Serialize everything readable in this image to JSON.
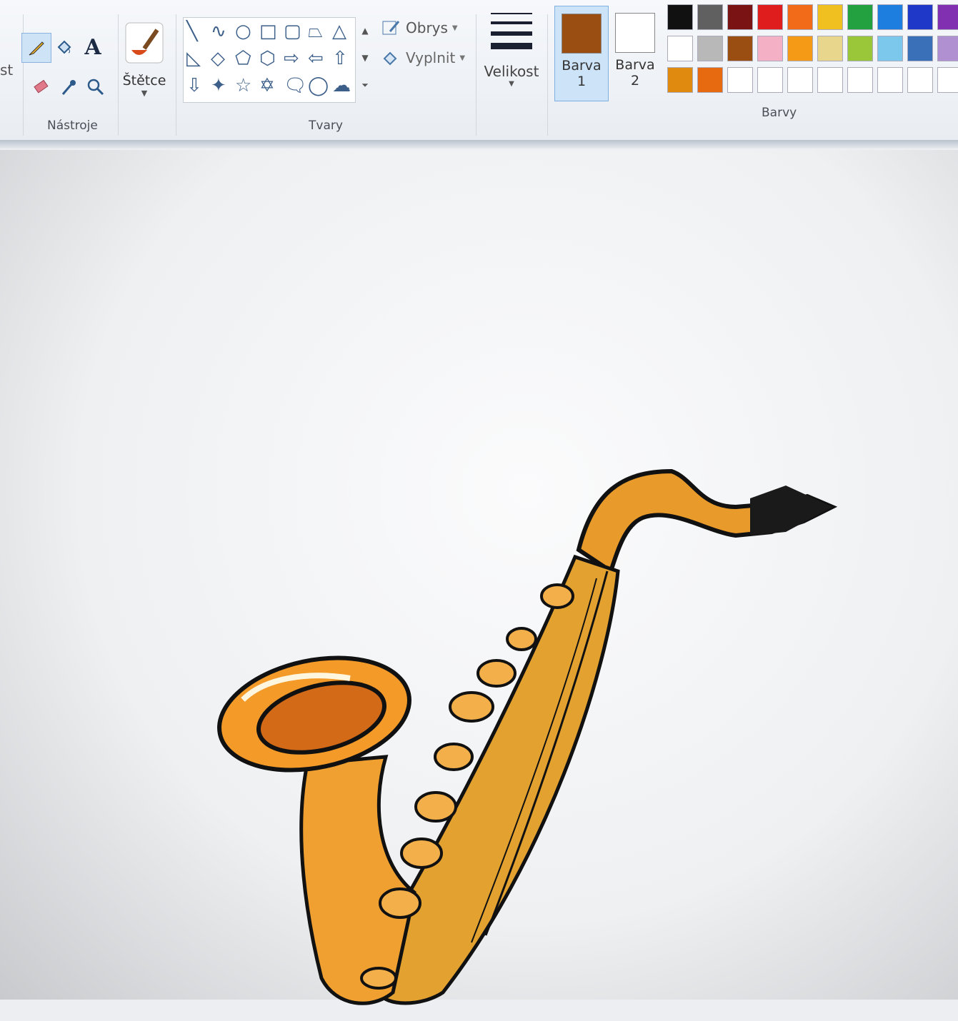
{
  "ribbon": {
    "left_cut_label": "st",
    "groups": {
      "tools": "Nástroje",
      "brushes": "Štětce",
      "shapes": "Tvary",
      "outline": "Obrys",
      "fill": "Vyplnit",
      "size": "Velikost",
      "colors": "Barvy"
    },
    "color1": {
      "label": "Barva",
      "number": "1",
      "value": "#9a4e12"
    },
    "color2": {
      "label": "Barva",
      "number": "2",
      "value": "#ffffff"
    }
  },
  "palette": [
    [
      "#111111",
      "#606060",
      "#7a1414",
      "#e01d1d",
      "#f26b18",
      "#f0c020",
      "#23a040",
      "#1e7ee0",
      "#2038c8",
      "#8030b0"
    ],
    [
      "#ffffff",
      "#b8b8b8",
      "#9a4e12",
      "#f4b0c4",
      "#f59a16",
      "#e8d68c",
      "#9ac63a",
      "#7cc8ec",
      "#3a70b8",
      "#b090d0"
    ],
    [
      "#e08a10",
      "#e86a10",
      "#ffffff",
      "#ffffff",
      "#ffffff",
      "#ffffff",
      "#ffffff",
      "#ffffff",
      "#ffffff",
      "#ffffff"
    ]
  ],
  "icons": {
    "pencil": "pencil-icon",
    "fill": "fill-bucket-icon",
    "text": "text-icon",
    "eraser": "eraser-icon",
    "picker": "color-picker-icon",
    "magnifier": "magnifier-icon"
  },
  "text_glyph": "A",
  "shape_glyphs": [
    [
      "╲",
      "∿",
      "○",
      "□",
      "▢",
      "⏢",
      "△"
    ],
    [
      "◺",
      "◇",
      "⬠",
      "⬡",
      "⇨",
      "⇦",
      "⇧"
    ],
    [
      "⇩",
      "✦",
      "☆",
      "✡",
      "🗨",
      "◯",
      "☁"
    ]
  ]
}
